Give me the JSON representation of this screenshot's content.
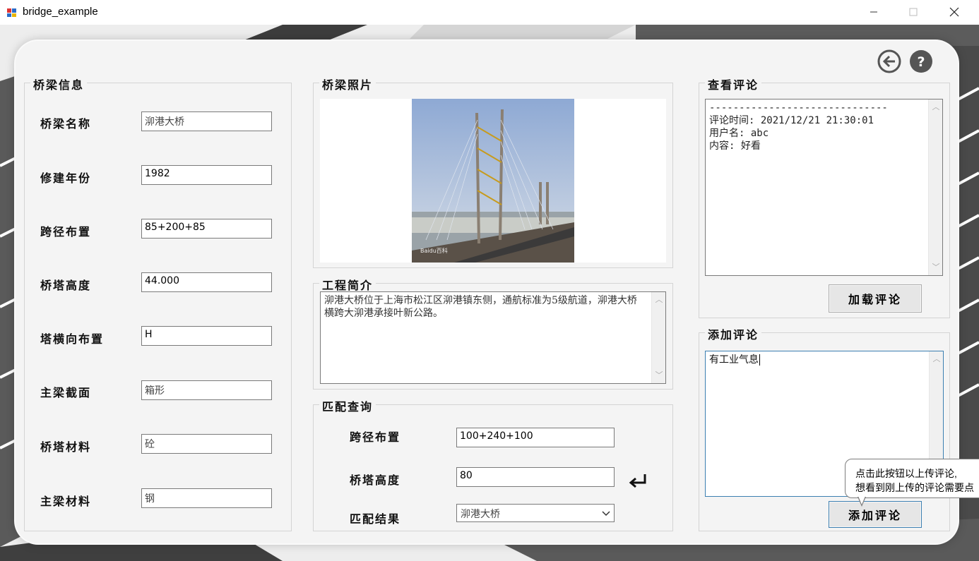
{
  "window": {
    "title": "bridge_example",
    "minimize_glyph": "—",
    "maximize_glyph": "☐",
    "close_glyph": "✕"
  },
  "bridge_info": {
    "legend": "桥梁信息",
    "fields": [
      {
        "label": "桥梁名称",
        "value": "泖港大桥"
      },
      {
        "label": "修建年份",
        "value": "1982"
      },
      {
        "label": "跨径布置",
        "value": "85+200+85"
      },
      {
        "label": "桥塔高度",
        "value": "44.000"
      },
      {
        "label": "塔横向布置",
        "value": "H"
      },
      {
        "label": "主梁截面",
        "value": "箱形"
      },
      {
        "label": "桥塔材料",
        "value": "砼"
      },
      {
        "label": "主梁材料",
        "value": "钢"
      }
    ]
  },
  "photo": {
    "legend": "桥梁照片",
    "watermark": "Baidu百科"
  },
  "intro": {
    "legend": "工程简介",
    "text": "泖港大桥位于上海市松江区泖港镇东侧，通航标准为5级航道，泖港大桥横跨大泖港承接叶新公路。"
  },
  "match": {
    "legend": "匹配查询",
    "span_label": "跨径布置",
    "span_value": "100+240+100",
    "height_label": "桥塔高度",
    "height_value": "80",
    "result_label": "匹配结果",
    "result_value": "泖港大桥"
  },
  "view_comments": {
    "legend": "查看评论",
    "divider": "------------------------------",
    "time_line": "评论时间: 2021/12/21 21:30:01",
    "user_line": "用户名: abc",
    "content_line": "内容: 好看",
    "load_button": "加载评论"
  },
  "add_comment": {
    "legend": "添加评论",
    "input_value": "有工业气息",
    "submit_button": "添加评论"
  },
  "tooltip": {
    "line1": "点击此按钮以上传评论,",
    "line2": "想看到刚上传的评论需要点"
  },
  "colors": {
    "panel": "#f4f4f4",
    "focus_border": "#3c7fb1",
    "icon_dark": "#555555"
  },
  "icons": [
    "back-arrow-icon",
    "help-icon",
    "enter-return-icon",
    "chevron-down-icon"
  ]
}
